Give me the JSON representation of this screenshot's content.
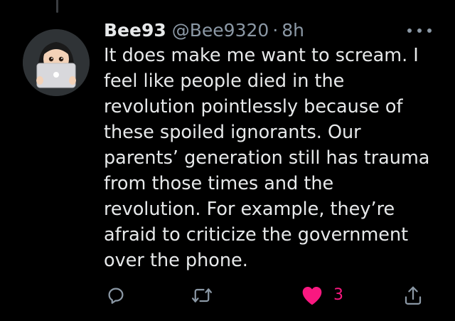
{
  "tweet": {
    "display_name": "Bee93",
    "handle": "@Bee9320",
    "separator": "·",
    "time": "8h",
    "text_lines": [
      "It does make me want to scream. I",
      "feel like people died in the",
      "revolution pointlessly because of",
      "these spoiled ignorants. Our",
      "parents’ generation still has trauma",
      "from those times and the",
      "revolution. For example, they’re",
      "afraid to criticize the government",
      "over the phone."
    ]
  },
  "actions": {
    "reply_icon": "reply-icon",
    "retweet_icon": "retweet-icon",
    "like_icon": "heart-filled-icon",
    "like_count": "3",
    "share_icon": "share-icon"
  },
  "colors": {
    "background": "#000000",
    "text": "#e7e9ea",
    "secondary": "#8b98a5",
    "like": "#f91880"
  }
}
